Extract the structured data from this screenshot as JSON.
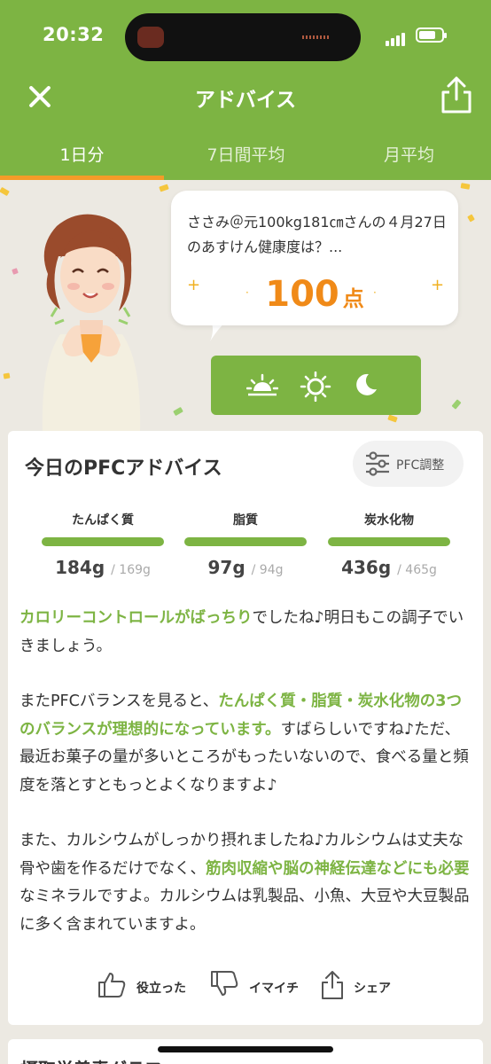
{
  "status_bar": {
    "time": "20:32"
  },
  "nav": {
    "title": "アドバイス"
  },
  "tabs": [
    {
      "label": "1日分",
      "active": true
    },
    {
      "label": "7日間平均",
      "active": false
    },
    {
      "label": "月平均",
      "active": false
    }
  ],
  "hero": {
    "message": "ささみ＠元100kg181㎝さんの４月27日のあすけん健康度は？...",
    "score": "100",
    "score_unit": "点",
    "time_icons": [
      "sunrise-icon",
      "sun-icon",
      "moon-icon"
    ]
  },
  "pfc_card": {
    "title": "今日のPFCアドバイス",
    "adjust_button": "PFC調整",
    "macros": [
      {
        "label": "たんぱく質",
        "value": "184g",
        "target": "/ 169g"
      },
      {
        "label": "脂質",
        "value": "97g",
        "target": "/ 94g"
      },
      {
        "label": "炭水化物",
        "value": "436g",
        "target": "/ 465g"
      }
    ],
    "advice": {
      "p1_hl": "カロリーコントロールがばっちり",
      "p1_rest": "でしたね♪明日もこの調子でいきましょう。",
      "p2_pre": "またPFCバランスを見ると、",
      "p2_hl": "たんぱく質・脂質・炭水化物の3つのバランスが理想的になっています。",
      "p2_rest": "すばらしいですね♪ただ、最近お菓子の量が多いところがもったいないので、食べる量と頻度を落とすともっとよくなりますよ♪",
      "p3_pre": "また、カルシウムがしっかり摂れましたね♪カルシウムは丈夫な骨や歯を作るだけでなく、",
      "p3_hl": "筋肉収縮や脳の神経伝達などにも必要",
      "p3_rest": "なミネラルですよ。カルシウムは乳製品、小魚、大豆や大豆製品に多く含まれていますよ。"
    },
    "actions": {
      "helpful": "役立った",
      "meh": "イマイチ",
      "share": "シェア"
    }
  },
  "next_section": {
    "title": "摂取栄養素グラフ"
  },
  "colors": {
    "brand_green": "#7db443",
    "accent_orange": "#f39c28"
  }
}
